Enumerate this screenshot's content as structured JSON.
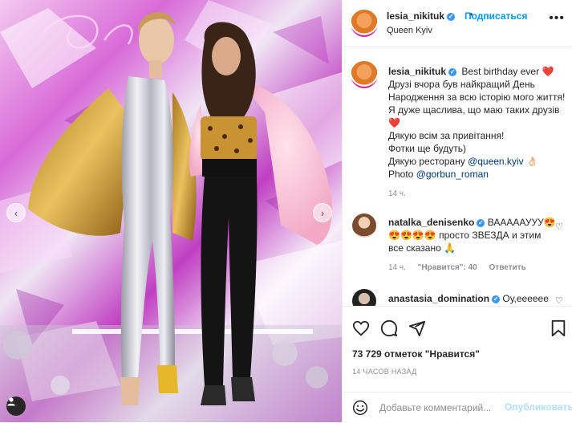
{
  "post": {
    "username": "lesia_nikituk",
    "follow_label": "Подписаться",
    "dot": "•",
    "location": "Queen Kyiv",
    "more": "•••"
  },
  "caption": {
    "username": "lesia_nikituk",
    "line1": "Best birthday ever",
    "line1_emoji": "❤️",
    "line2": "Друзі вчора був найкращий День Народження за всю історію мого життя! Я дуже щаслива, що маю таких друзів",
    "line2_emoji": "❤️",
    "line3": "Дякую всім за привітання!",
    "line4": "Фотки ще будуть)",
    "line5_prefix": "Дякую ресторану",
    "line5_link": "@queen.kyiv",
    "line5_emoji": "👌🏻",
    "line6_prefix": "Photo",
    "line6_link": "@gorbun_roman",
    "time": "14 ч."
  },
  "comments": [
    {
      "username": "natalka_denisenko",
      "text_start": "ВАААААУУУ😍",
      "text_rest": "😍😍😍😍 просто ЗВЕЗДА и этим все сказано 🙏",
      "time": "14 ч.",
      "likes": "\"Нравится\": 40",
      "reply": "Ответить"
    },
    {
      "username": "anastasia_domination",
      "text": "Оу,eeeeee"
    }
  ],
  "stats": {
    "likes": "73 729 отметок \"Нравится\"",
    "time_ago": "14 ЧАСОВ НАЗАД"
  },
  "comment_box": {
    "placeholder": "Добавьте комментарий...",
    "publish": "Опубликовать"
  },
  "icons": [
    "chevron-left-icon",
    "chevron-right-icon",
    "user-tag-icon",
    "verified-icon",
    "heart-icon",
    "comment-icon",
    "share-icon",
    "bookmark-icon",
    "emoji-icon"
  ],
  "colors": {
    "accent": "#0095f6",
    "verified": "#3897f0",
    "publish_disabled": "#b2dffc",
    "text": "#262626",
    "muted": "#8e8e8e"
  }
}
